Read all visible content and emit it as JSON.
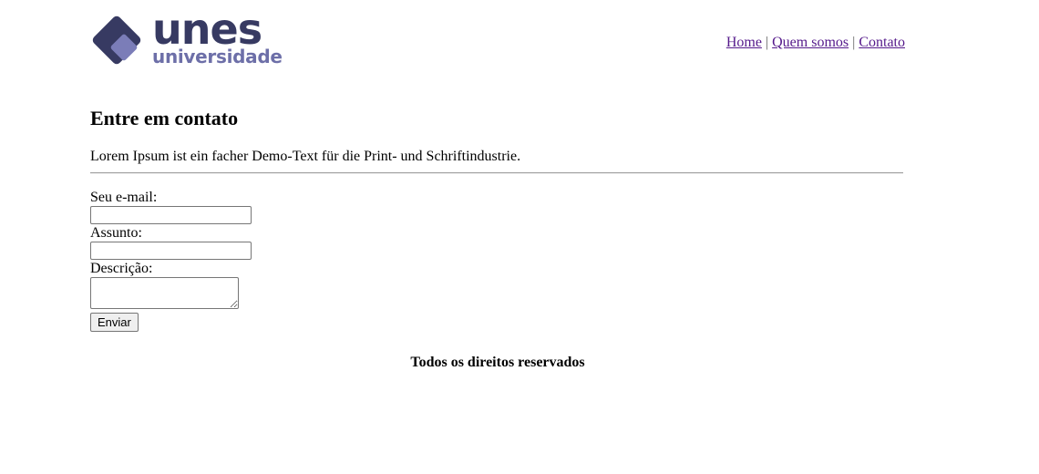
{
  "brand": {
    "name": "unes",
    "subtitle": "universidade",
    "colors": {
      "dark": "#373a62",
      "light": "#6d6fa8"
    }
  },
  "nav": {
    "links": [
      "Home",
      "Quem somos",
      "Contato"
    ],
    "separator": "|"
  },
  "page": {
    "title": "Entre em contato",
    "lead": "Lorem Ipsum ist ein facher Demo-Text für die Print- und Schriftindustrie."
  },
  "form": {
    "email_label": "Seu e-mail:",
    "email_value": "",
    "subject_label": "Assunto:",
    "subject_value": "",
    "description_label": "Descrição:",
    "description_value": "",
    "submit_label": "Enviar"
  },
  "footer": {
    "text": "Todos os direitos reservados"
  }
}
